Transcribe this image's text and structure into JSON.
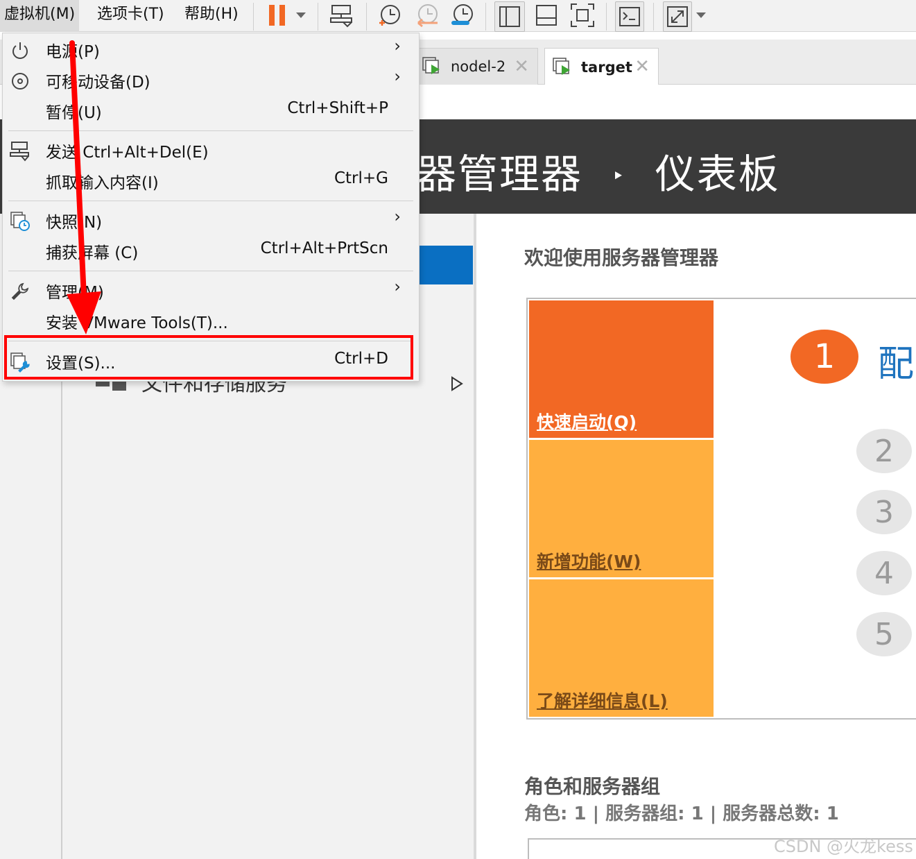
{
  "menubar": {
    "items": [
      {
        "label": "虚拟机(M)"
      },
      {
        "label": "选项卡(T)"
      },
      {
        "label": "帮助(H)"
      }
    ]
  },
  "toolbar": {
    "icons": [
      "pause-icon",
      "dropdown-icon",
      "send-ctrl-alt-del-icon",
      "snapshot-take-icon",
      "snapshot-revert-icon",
      "snapshot-manager-icon",
      "library-view-icon",
      "console-view-icon",
      "fullscreen-icon",
      "terminal-icon",
      "stretch-icon",
      "dropdown-icon"
    ]
  },
  "tabs": [
    {
      "label": "nodel-2",
      "active": false
    },
    {
      "label": "target",
      "active": true
    }
  ],
  "dropdown": {
    "items": [
      {
        "label": "电源(P)",
        "shortcut": "",
        "submenu": true,
        "icon": "power-icon"
      },
      {
        "label": "可移动设备(D)",
        "shortcut": "",
        "submenu": true,
        "icon": "disc-icon"
      },
      {
        "label": "暂停(U)",
        "shortcut": "Ctrl+Shift+P",
        "submenu": false,
        "icon": ""
      },
      {
        "label": "发送 Ctrl+Alt+Del(E)",
        "shortcut": "",
        "submenu": false,
        "icon": "send-keys-icon"
      },
      {
        "label": "抓取输入内容(I)",
        "shortcut": "Ctrl+G",
        "submenu": false,
        "icon": ""
      },
      {
        "label": "快照(N)",
        "shortcut": "",
        "submenu": true,
        "icon": "snapshot-icon"
      },
      {
        "label": "捕获屏幕 (C)",
        "shortcut": "Ctrl+Alt+PrtScn",
        "submenu": false,
        "icon": ""
      },
      {
        "label": "管理(M)",
        "shortcut": "",
        "submenu": true,
        "icon": "wrench-icon"
      },
      {
        "label": "安装 VMware Tools(T)...",
        "shortcut": "",
        "submenu": false,
        "icon": ""
      },
      {
        "label": "设置(S)...",
        "shortcut": "Ctrl+D",
        "submenu": false,
        "icon": "settings-icon"
      }
    ]
  },
  "server_manager": {
    "header_title": "器管理器",
    "header_sep": "‣",
    "header_page": "仪表板",
    "left_item": "文件和存储服务",
    "welcome": "欢迎使用服务器管理器",
    "tiles": {
      "quick": "快速启动(Q)",
      "new": "新增功能(W)",
      "learn": "了解详细信息(L)"
    },
    "step1": "1",
    "config_text": "配",
    "steps": [
      "2",
      "3",
      "4",
      "5"
    ],
    "roles_title": "角色和服务器组",
    "roles_sub": "角色: 1 | 服务器组: 1 | 服务器总数: 1"
  },
  "watermark": "CSDN @火龙kess",
  "colors": {
    "accent_orange": "#f26824",
    "tile_orange": "#ffaf3f",
    "blue": "#0a6fc2",
    "annotation_red": "#ff0000"
  }
}
